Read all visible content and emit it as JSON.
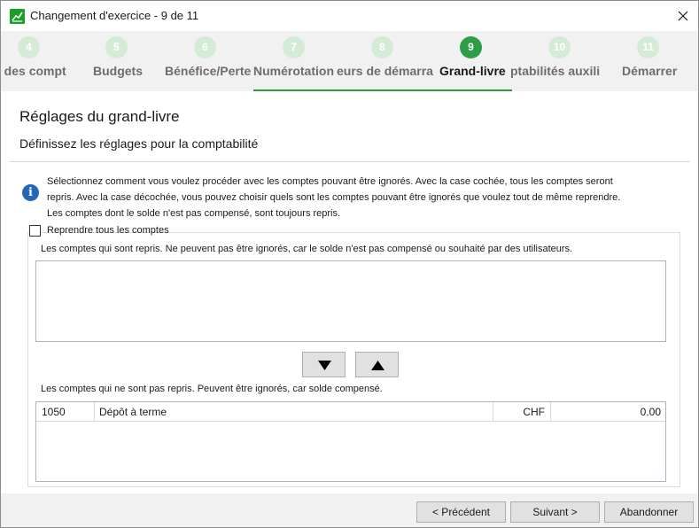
{
  "window": {
    "title": "Changement d'exercice - 9 de 11"
  },
  "steps": [
    {
      "number": "4",
      "label": "s des compt"
    },
    {
      "number": "5",
      "label": "Budgets"
    },
    {
      "number": "6",
      "label": "Bénéfice/Perte"
    },
    {
      "number": "7",
      "label": "Numérotation"
    },
    {
      "number": "8",
      "label": "eurs de démarra"
    },
    {
      "number": "9",
      "label": "Grand-livre"
    },
    {
      "number": "10",
      "label": "ptabilités auxili"
    },
    {
      "number": "11",
      "label": "Démarrer"
    }
  ],
  "active_step": "9",
  "page": {
    "heading": "Réglages du grand-livre",
    "subheading": "Définissez les réglages pour la comptabilité",
    "info_line1": "Sélectionnez comment vous voulez procéder avec les comptes pouvant être ignorés. Avec la case cochée, tous les comptes seront",
    "info_line2": "repris. Avec la case décochée, vous pouvez choisir quels sont les comptes pouvant être ignorés que voulez tout de même reprendre.",
    "info_line3": "Les comptes dont le solde n'est pas compensé, sont toujours repris."
  },
  "options": {
    "take_all_label": "Reprendre tous les comptes",
    "take_all_checked": false
  },
  "upper_list": {
    "caption": "Les comptes qui sont repris. Ne peuvent pas être ignorés, car le solde n'est pas compensé ou souhaité par des utilisateurs.",
    "rows": []
  },
  "lower_list": {
    "caption": "Les comptes qui ne sont pas repris. Peuvent être ignorés, car solde compensé.",
    "rows": [
      {
        "account": "1050",
        "description": "Dépôt à terme",
        "currency": "CHF",
        "balance": "0.00"
      }
    ]
  },
  "footer": {
    "previous_label": "< Précédent",
    "next_label": "Suivant >",
    "cancel_label": "Abandonner"
  },
  "colors": {
    "accent": "#2e9d47",
    "step_inactive": "#d4ecd5",
    "info_icon": "#2666b8"
  },
  "icons": {
    "app": "chart-trend-icon",
    "close": "close-icon",
    "info": "info-icon",
    "move_down": "triangle-down-icon",
    "move_up": "triangle-up-icon"
  }
}
